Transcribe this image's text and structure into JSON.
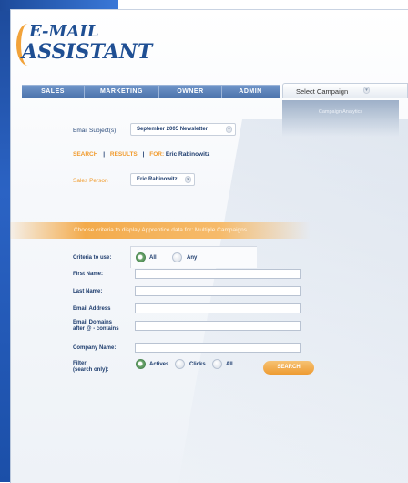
{
  "app": {
    "logo_line1": "E-MAIL",
    "logo_line2": "ASSISTANT"
  },
  "nav": {
    "tabs": [
      "SALES",
      "MARKETING",
      "OWNER",
      "ADMIN"
    ]
  },
  "campaign": {
    "select_label": "Select Campaign",
    "panel_text": "Campaign Analytics"
  },
  "form_top": {
    "subject_label": "Email Subject(s)",
    "subject_value": "September 2005 Newsletter",
    "link_search": "SEARCH",
    "link_results": "RESULTS",
    "for_label": "FOR:",
    "for_name": "Eric Rabinowitz",
    "sales_person_label": "Sales Person",
    "sales_person_value": "Eric Rabinowitz"
  },
  "banner": {
    "text": "Choose criteria to display Apprentice data for: Multiple Campaigns"
  },
  "criteria": {
    "criteria_label": "Criteria to use:",
    "opt_all": "All",
    "opt_any": "Any",
    "first_name_label": "First Name:",
    "last_name_label": "Last Name:",
    "email_label": "Email Address",
    "domains_label_1": "Email Domains",
    "domains_label_2": "after @ - contains",
    "company_label": "Company Name:",
    "filter_label_1": "Filter",
    "filter_label_2": "(search only):",
    "filter_actives": "Actives",
    "filter_clicks": "Clicks",
    "filter_all": "All",
    "go_button": "SEARCH",
    "first_name_value": "",
    "last_name_value": "",
    "email_value": "",
    "domains_value": "",
    "company_value": ""
  },
  "colors": {
    "brand_blue": "#1f4f93",
    "accent_orange": "#f19b2c",
    "nav_blue": "#5a80b8"
  }
}
